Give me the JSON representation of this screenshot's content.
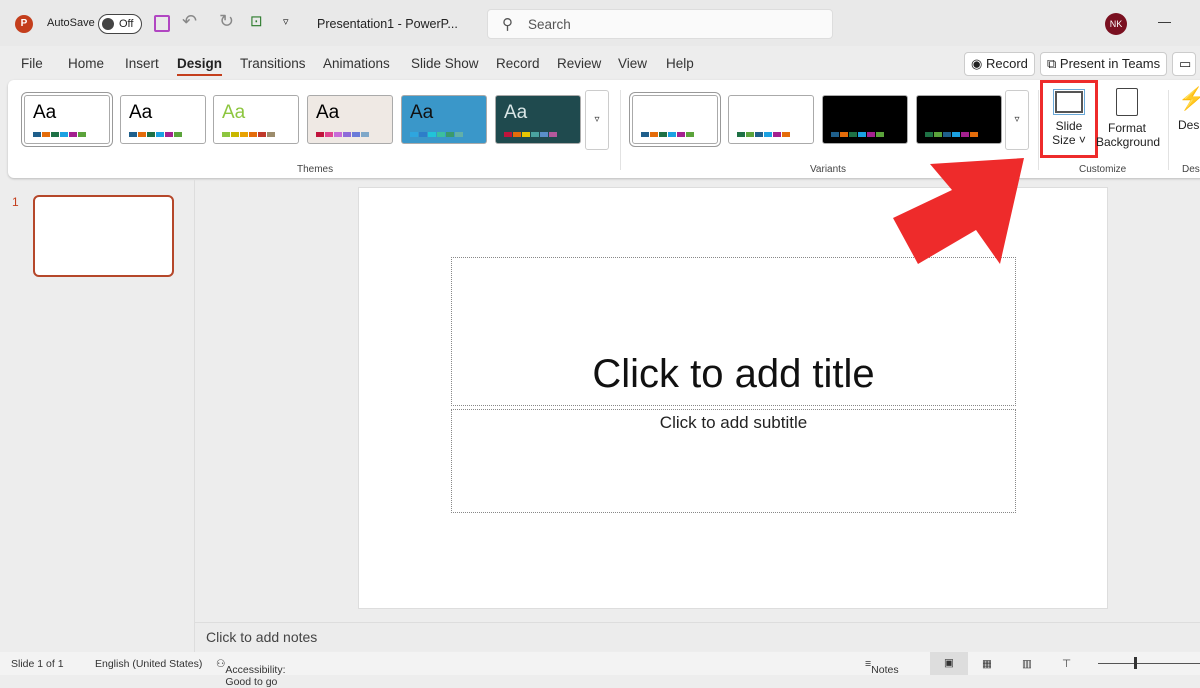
{
  "titlebar": {
    "app_icon": "P",
    "autosave_label": "AutoSave",
    "autosave_state": "Off",
    "doc_title": "Presentation1  -  PowerP...",
    "search_placeholder": "Search",
    "avatar": "NK",
    "minimize": "—"
  },
  "tabs": [
    "File",
    "Home",
    "Insert",
    "Design",
    "Transitions",
    "Animations",
    "Slide Show",
    "Record",
    "Review",
    "View",
    "Help"
  ],
  "active_tab": "Design",
  "actions": {
    "record": "Record",
    "present": "Present in Teams"
  },
  "ribbon": {
    "themes_label": "Themes",
    "variants_label": "Variants",
    "customize_label": "Customize",
    "designer_label": "Des",
    "themes": [
      {
        "aa": "Aa",
        "bg": "#ffffff",
        "fg": "#000",
        "sw": [
          "#1f5f8b",
          "#e46c0a",
          "#1e7145",
          "#1ba1e2",
          "#a4218f",
          "#5ba33b"
        ]
      },
      {
        "aa": "Aa",
        "bg": "#ffffff",
        "fg": "#000",
        "sw": [
          "#1f5f8b",
          "#e46c0a",
          "#1e7145",
          "#1ba1e2",
          "#a4218f",
          "#5ba33b"
        ]
      },
      {
        "aa": "Aa",
        "bg": "#ffffff",
        "fg": "#8dc63f",
        "sw": [
          "#8dc63f",
          "#c9b800",
          "#e8a202",
          "#e46c0a",
          "#c0392b",
          "#9c8c6c"
        ]
      },
      {
        "aa": "Aa",
        "bg": "#efe9e4",
        "fg": "#000",
        "sw": [
          "#c0143c",
          "#e0448e",
          "#c86bd9",
          "#8e6bd9",
          "#6b7bd9",
          "#7fa8c9"
        ]
      },
      {
        "aa": "Aa",
        "bg": "#3a97c9",
        "fg": "#111",
        "sw": [
          "#2ea6df",
          "#2d7ec9",
          "#21c4d9",
          "#3bbfa0",
          "#3a9a6c",
          "#62b0a8"
        ]
      },
      {
        "aa": "Aa",
        "bg": "#1f4a4e",
        "fg": "#d9e6e6",
        "sw": [
          "#c0143c",
          "#e46c0a",
          "#e8c602",
          "#4aa3a0",
          "#5a8fc9",
          "#b4589c"
        ]
      }
    ],
    "variants": [
      {
        "bg": "#ffffff",
        "sw": [
          "#1f5f8b",
          "#e46c0a",
          "#1e7145",
          "#1ba1e2",
          "#a4218f",
          "#5ba33b"
        ]
      },
      {
        "bg": "#ffffff",
        "sw": [
          "#1e7145",
          "#5ba33b",
          "#1f5f8b",
          "#1ba1e2",
          "#a4218f",
          "#e46c0a"
        ]
      },
      {
        "bg": "#000000",
        "sw": [
          "#1f5f8b",
          "#e46c0a",
          "#1e7145",
          "#1ba1e2",
          "#a4218f",
          "#5ba33b"
        ]
      },
      {
        "bg": "#000000",
        "sw": [
          "#1e7145",
          "#5ba33b",
          "#1f5f8b",
          "#1ba1e2",
          "#a4218f",
          "#e46c0a"
        ]
      }
    ],
    "slide_size": [
      "Slide",
      "Size ˅"
    ],
    "format_bg": [
      "Format",
      "Background"
    ]
  },
  "thumbnail_number": "1",
  "slide": {
    "title": "Click to add title",
    "subtitle": "Click to add subtitle"
  },
  "notes_placeholder": "Click to add notes",
  "status": {
    "slide": "Slide 1 of 1",
    "language": "English (United States)",
    "accessibility": "Accessibility: Good to go",
    "notes": "Notes"
  },
  "colors": {
    "accent": "#c43e1c",
    "highlight": "#ee2b2b"
  }
}
